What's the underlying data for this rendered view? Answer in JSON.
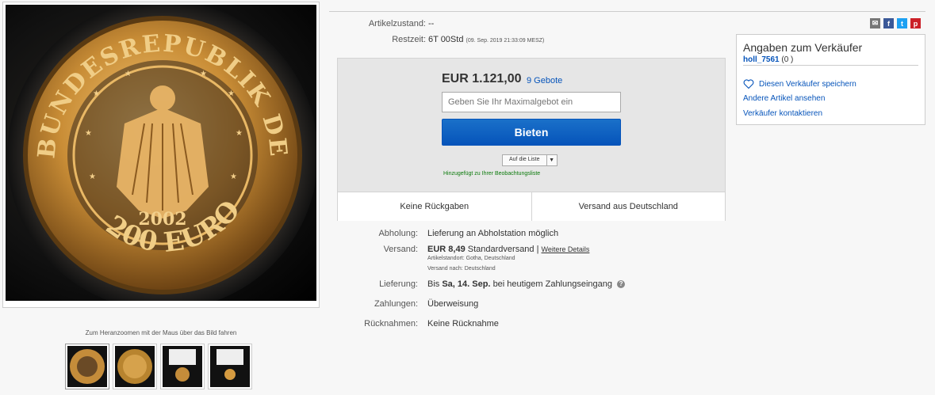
{
  "item": {
    "condition_label": "Artikelzustand:",
    "condition_value": "--",
    "time_label": "Restzeit:",
    "time_value": "6T 00Std",
    "time_detail": "(09. Sep. 2019   21:33:09 MESZ)"
  },
  "bid": {
    "price": "EUR 1.121,00",
    "bids_link": "9 Gebote",
    "max_bid_placeholder": "Geben Sie Ihr Maximalgebot ein",
    "bid_button": "Bieten",
    "watchlist_button": "Auf die Liste",
    "watchlist_note": "Hinzugefügt zu Ihrer Beobachtungsliste",
    "returns": "Keine Rückgaben",
    "shipping_from": "Versand aus Deutschland"
  },
  "details": {
    "pickup_label": "Abholung:",
    "pickup_value": "Lieferung an Abholstation möglich",
    "shipping_label": "Versand:",
    "shipping_price": "EUR 8,49",
    "shipping_type": "Standardversand",
    "shipping_more": "Weitere Details",
    "item_location": "Artikelstandort:  Gotha, Deutschland",
    "ship_to": "Versand nach:  Deutschland",
    "delivery_label": "Lieferung:",
    "delivery_prefix": "Bis",
    "delivery_date": "Sa, 14. Sep.",
    "delivery_suffix": "bei heutigem Zahlungseingang",
    "payment_label": "Zahlungen:",
    "payment_value": "Überweisung",
    "returns_label": "Rücknahmen:",
    "returns_value": "Keine Rücknahme"
  },
  "gallery": {
    "zoom_hint": "Zum Heranzoomen mit der Maus über das Bild fahren",
    "coin_year": "2002",
    "coin_top_text": "BUNDESREPUBLIK DEUTSCHLAND",
    "coin_bottom_text": "200 EURO"
  },
  "seller": {
    "title": "Angaben zum Verkäufer",
    "name": "holl_7561",
    "feedback": "(0 )",
    "save_link": "Diesen Verkäufer speichern",
    "other_items_link": "Andere Artikel ansehen",
    "contact_link": "Verkäufer kontaktieren"
  },
  "share": {
    "icons": [
      "mail-icon",
      "facebook-icon",
      "twitter-icon",
      "pinterest-icon"
    ],
    "colors": {
      "mail": "#777777",
      "facebook": "#3b5998",
      "twitter": "#1da1f2",
      "pinterest": "#cb2027"
    }
  },
  "colors": {
    "link": "#0654ba",
    "bid_button": "#0654ba",
    "watch_note": "#0b7a0b"
  }
}
